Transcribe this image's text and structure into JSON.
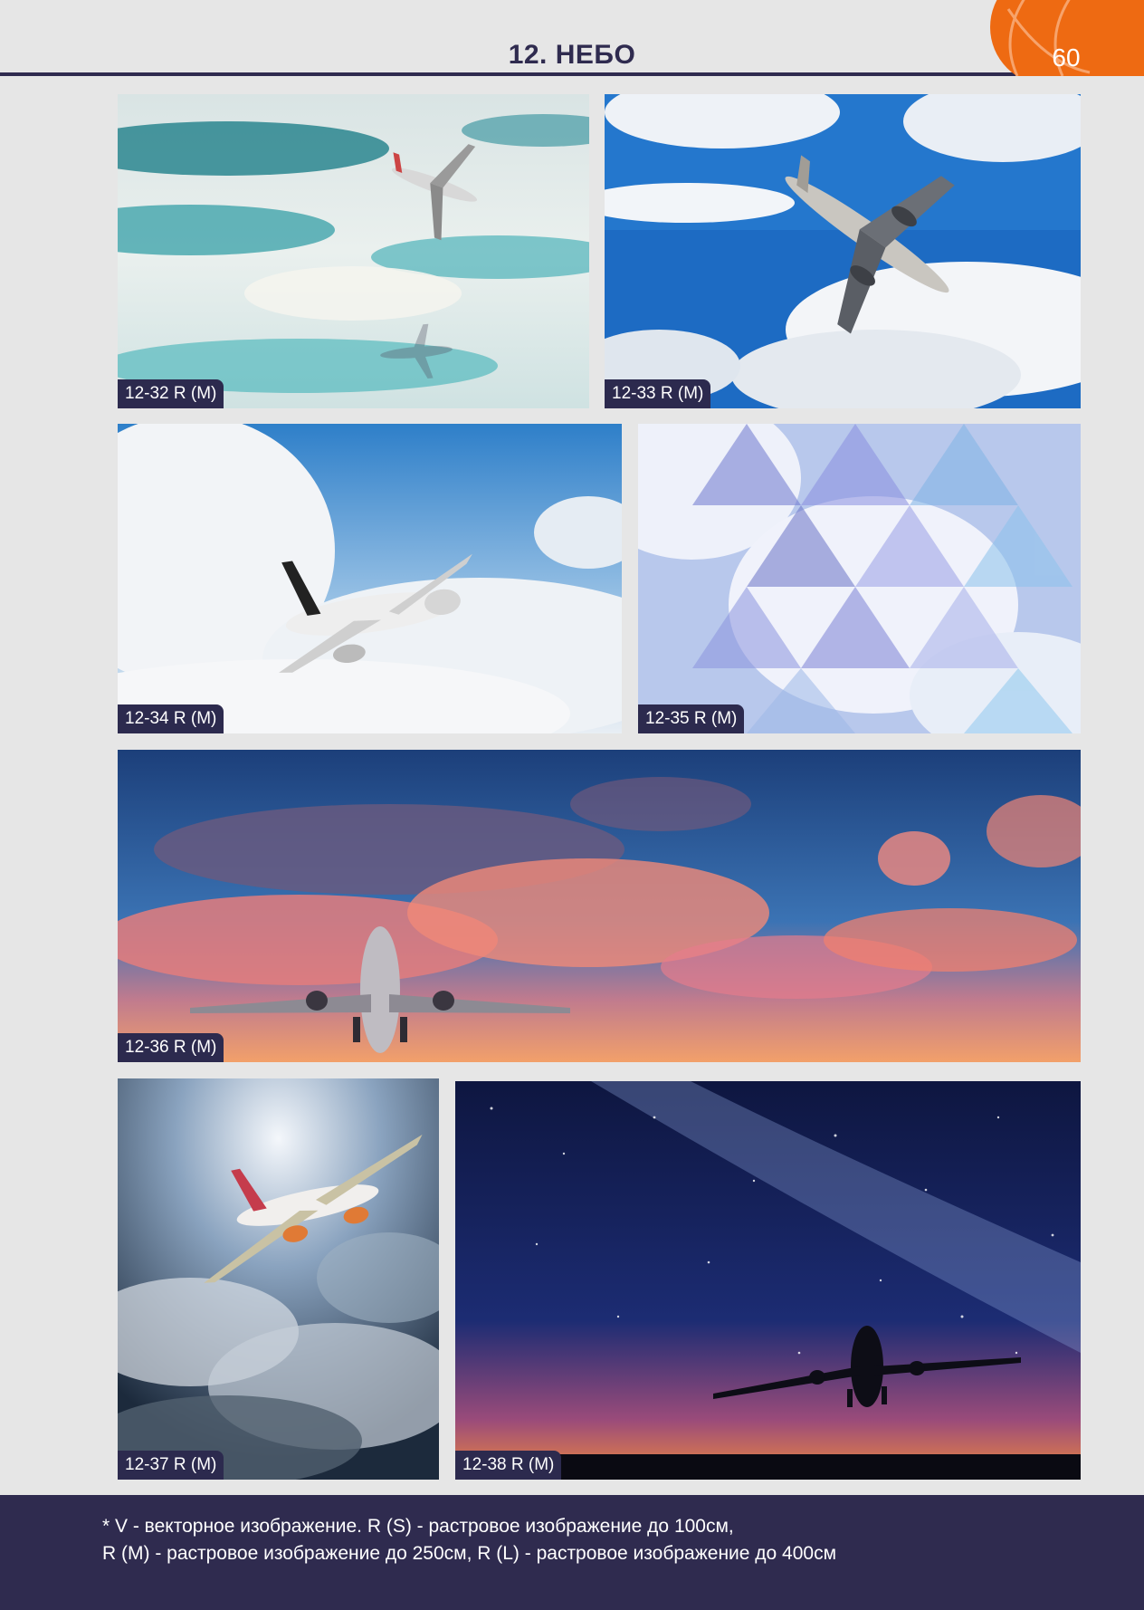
{
  "header": {
    "title": "12. НЕБО",
    "page_number": "60",
    "accent_color": "#ee6a12",
    "rule_color": "#2f2b4f"
  },
  "images": [
    {
      "code": "12-32 R (M)",
      "subject": "airplane-icon"
    },
    {
      "code": "12-33 R (M)",
      "subject": "airplane-icon"
    },
    {
      "code": "12-34 R (M)",
      "subject": "airplane-icon"
    },
    {
      "code": "12-35 R (M)",
      "subject": "triangle-pattern-icon"
    },
    {
      "code": "12-36 R (M)",
      "subject": "airplane-icon"
    },
    {
      "code": "12-37 R (M)",
      "subject": "airplane-icon"
    },
    {
      "code": "12-38 R (M)",
      "subject": "airplane-icon"
    }
  ],
  "footer": {
    "line1": "* V - векторное изображение. R (S) - растровое изображение до 100см,",
    "line2": "R (M) - растровое изображение до 250см, R (L) - растровое изображение до 400см",
    "background": "#2f2b4f"
  }
}
